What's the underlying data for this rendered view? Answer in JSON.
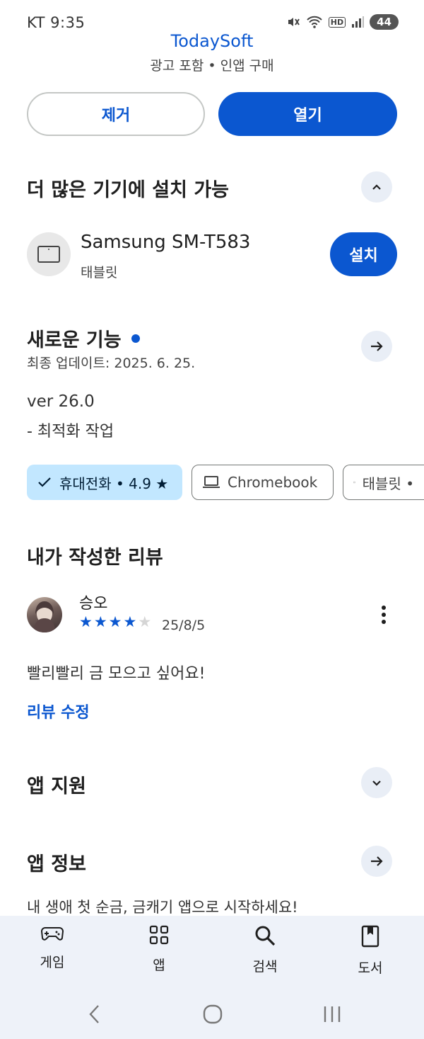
{
  "status_bar": {
    "carrier_time": "KT 9:35",
    "battery": "44",
    "hd_label": "HD"
  },
  "app": {
    "developer": "TodaySoft",
    "subtitle": "광고 포함 • 인앱 구매"
  },
  "actions": {
    "remove_label": "제거",
    "open_label": "열기"
  },
  "more_devices": {
    "title": "더 많은 기기에 설치 가능",
    "device_name": "Samsung SM-T583",
    "device_type": "태블릿",
    "install_label": "설치"
  },
  "whats_new": {
    "title": "새로운 기능",
    "updated": "최종 업데이트: 2025. 6. 25.",
    "version": "ver 26.0",
    "note": "- 최적화 작업"
  },
  "device_chips": [
    {
      "label": "휴대전화 • 4.9 ★",
      "selected": true
    },
    {
      "label": "Chromebook",
      "selected": false
    },
    {
      "label": "태블릿 •",
      "selected": false
    }
  ],
  "my_review": {
    "title": "내가 작성한 리뷰",
    "reviewer": "승오",
    "rating": 4,
    "max_rating": 5,
    "date": "25/8/5",
    "text": "빨리빨리 금 모으고 싶어요!",
    "edit_label": "리뷰 수정"
  },
  "app_support": {
    "title": "앱 지원"
  },
  "app_info": {
    "title": "앱 정보",
    "description": "내 생애 첫 순금, 금캐기 앱으로 시작하세요!"
  },
  "bottom_nav": [
    {
      "label": "게임",
      "icon": "gamepad-icon"
    },
    {
      "label": "앱",
      "icon": "apps-grid-icon"
    },
    {
      "label": "검색",
      "icon": "search-icon"
    },
    {
      "label": "도서",
      "icon": "book-icon"
    }
  ],
  "colors": {
    "accent": "#0b57d0",
    "chip_selected": "#c2e7ff",
    "nav_bg": "#eef2f9"
  }
}
